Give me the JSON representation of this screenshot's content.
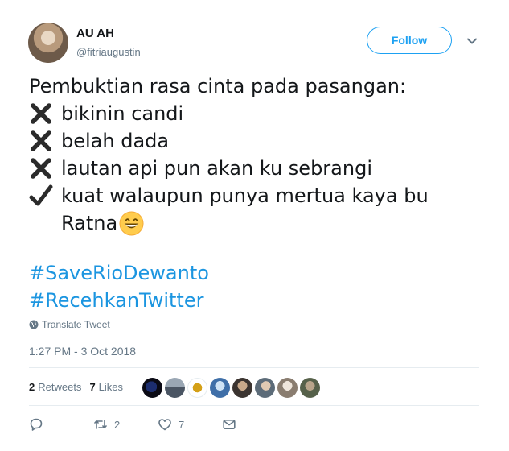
{
  "header": {
    "display_name": "AU AH",
    "handle": "@fitriaugustin",
    "follow_label": "Follow"
  },
  "tweet": {
    "intro": "Pembuktian rasa cinta pada pasangan:",
    "items": [
      {
        "mark": "cross",
        "text": "bikinin candi"
      },
      {
        "mark": "cross",
        "text": "belah dada"
      },
      {
        "mark": "cross",
        "text": "lautan api pun akan ku sebrangi"
      },
      {
        "mark": "check",
        "text": "kuat walaupun punya mertua kaya bu"
      }
    ],
    "continuation": "Ratna",
    "emoji": "grinning-face-emoji",
    "hashtags": [
      "#SaveRioDewanto",
      "#RecehkanTwitter"
    ]
  },
  "translate_label": "Translate Tweet",
  "timestamp": "1:27 PM - 3 Oct 2018",
  "stats": {
    "retweets_count": "2",
    "retweets_label": "Retweets",
    "likes_count": "7",
    "likes_label": "Likes"
  },
  "actions": {
    "reply_count": "",
    "retweet_count": "2",
    "like_count": "7"
  },
  "colors": {
    "accent": "#1da1f2",
    "hashtag": "#1b95e0",
    "muted": "#657786",
    "text": "#14171a",
    "divider": "#e6ecf0"
  }
}
